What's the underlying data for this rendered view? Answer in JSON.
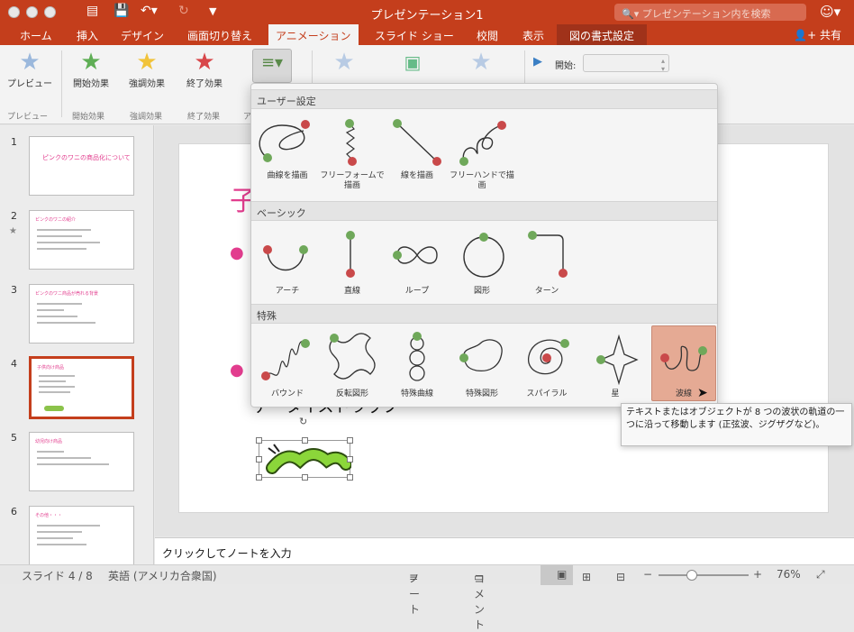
{
  "window": {
    "title": "プレゼンテーション1",
    "search_placeholder": "プレゼンテーション内を検索"
  },
  "tabs": [
    "ホーム",
    "挿入",
    "デザイン",
    "画面切り替え",
    "アニメーション",
    "スライド ショー",
    "校閲",
    "表示",
    "図の書式設定"
  ],
  "active_tab": "アニメーション",
  "share_label": "共有",
  "ribbon": {
    "preview_label": "プレビュー",
    "entrance_label": "開始効果",
    "emphasis_label": "強調効果",
    "exit_label": "終了効果",
    "start_label": "開始:",
    "groups": [
      "プレビュー",
      "開始効果",
      "強調効果",
      "終了効果",
      "ア"
    ]
  },
  "dropdown": {
    "sections": [
      {
        "title": "ユーザー設定",
        "items": [
          "曲線を描画",
          "フリーフォームで描画",
          "線を描画",
          "フリーハンドで描画"
        ]
      },
      {
        "title": "ベーシック",
        "items": [
          "アーチ",
          "直線",
          "ループ",
          "図形",
          "ターン"
        ]
      },
      {
        "title": "特殊",
        "items": [
          "バウンド",
          "反転図形",
          "特殊曲線",
          "特殊図形",
          "スパイラル",
          "星",
          "波線"
        ]
      }
    ],
    "selected_item": "波線",
    "tooltip": "テキストまたはオブジェクトが 8 つの波状の軌道の一つに沿って移動します (正弦波、ジグザグなど)。"
  },
  "slides": [
    {
      "num": "1",
      "title": "ピンクのワニの商品化について"
    },
    {
      "num": "2",
      "title": "ピンクのワニの紹介"
    },
    {
      "num": "3",
      "title": "ピンクのワニ商品が売れる背景"
    },
    {
      "num": "4",
      "title": "子供向け商品"
    },
    {
      "num": "5",
      "title": "幼児向け商品"
    },
    {
      "num": "6",
      "title": "その他・・・"
    }
  ],
  "current_slide": {
    "visible_text": "データイストラップ"
  },
  "notes_placeholder": "クリックしてノートを入力",
  "status": {
    "slide_indicator": "スライド 4 / 8",
    "language": "英語 (アメリカ合衆国)",
    "notes_label": "ノート",
    "comments_label": "コメント",
    "zoom": "76%"
  },
  "colors": {
    "accent": "#c43e1c",
    "green_dot": "#6fa85a",
    "red_dot": "#c9494a",
    "pink_text": "#e23d8e"
  }
}
